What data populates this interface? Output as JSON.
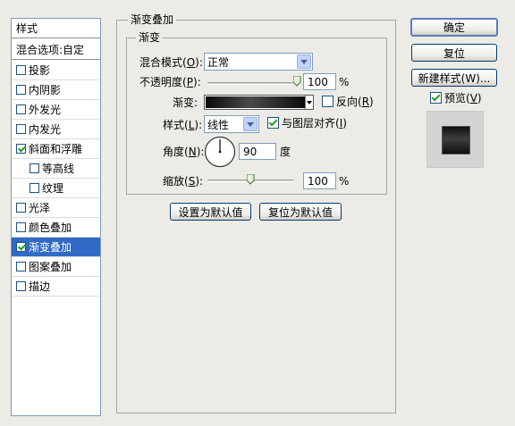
{
  "style_list": {
    "header": "样式",
    "blend_options": "混合选项:自定",
    "items": [
      {
        "label": "投影",
        "checked": false
      },
      {
        "label": "内阴影",
        "checked": false
      },
      {
        "label": "外发光",
        "checked": false
      },
      {
        "label": "内发光",
        "checked": false
      },
      {
        "label": "斜面和浮雕",
        "checked": true
      },
      {
        "label": "等高线",
        "checked": false
      },
      {
        "label": "纹理",
        "checked": false
      },
      {
        "label": "光泽",
        "checked": false
      },
      {
        "label": "颜色叠加",
        "checked": false
      },
      {
        "label": "渐变叠加",
        "checked": true,
        "selected": true
      },
      {
        "label": "图案叠加",
        "checked": false
      },
      {
        "label": "描边",
        "checked": false
      }
    ]
  },
  "panel": {
    "outer_title": "渐变叠加",
    "inner_title": "渐变",
    "blend_mode": {
      "label": "混合模式",
      "key": "O",
      "value": "正常"
    },
    "opacity": {
      "label": "不透明度",
      "key": "P",
      "value": "100",
      "unit": "%",
      "fraction": 1.0
    },
    "gradient": {
      "label": "渐变:",
      "reverse_label": "反向",
      "reverse_key": "R",
      "reverse_checked": false
    },
    "style": {
      "label": "样式",
      "key": "L",
      "value": "线性",
      "align_label": "与图层对齐",
      "align_key": "I",
      "align_checked": true
    },
    "angle": {
      "label": "角度",
      "key": "N",
      "value": "90",
      "unit": "度",
      "degrees": 90
    },
    "scale": {
      "label": "缩放",
      "key": "S",
      "value": "100",
      "unit": "%",
      "fraction": 0.5
    },
    "set_default": "设置为默认值",
    "reset_default": "复位为默认值"
  },
  "buttons": {
    "ok": "确定",
    "reset": "复位",
    "new_style": "新建样式(W)...",
    "preview": "预览",
    "preview_key": "V",
    "preview_checked": true
  }
}
